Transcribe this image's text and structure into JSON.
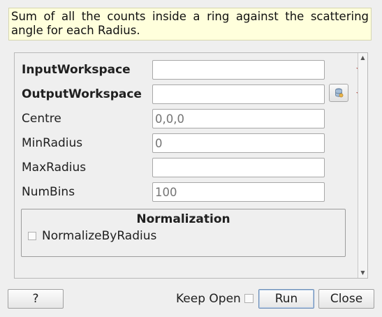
{
  "description": "Sum of all the counts inside a ring against the scattering angle for each Radius.",
  "properties": [
    {
      "name": "InputWorkspace",
      "value": "",
      "placeholder": "",
      "required": true,
      "bold": true,
      "browse": false
    },
    {
      "name": "OutputWorkspace",
      "value": "",
      "placeholder": "",
      "required": true,
      "bold": true,
      "browse": true
    },
    {
      "name": "Centre",
      "value": "",
      "placeholder": "0,0,0",
      "required": false,
      "bold": false,
      "browse": false
    },
    {
      "name": "MinRadius",
      "value": "",
      "placeholder": "0",
      "required": false,
      "bold": false,
      "browse": false
    },
    {
      "name": "MaxRadius",
      "value": "",
      "placeholder": "",
      "required": false,
      "bold": false,
      "browse": false
    },
    {
      "name": "NumBins",
      "value": "",
      "placeholder": "100",
      "required": false,
      "bold": false,
      "browse": false
    }
  ],
  "normalization": {
    "title": "Normalization",
    "checkbox_label": "NormalizeByRadius",
    "checked": false
  },
  "buttons": {
    "help": "?",
    "keep_open": "Keep Open",
    "keep_open_checked": false,
    "run": "Run",
    "close": "Close"
  },
  "colors": {
    "required_marker": "#c0392b",
    "tooltip_bg": "#ffffdc"
  }
}
